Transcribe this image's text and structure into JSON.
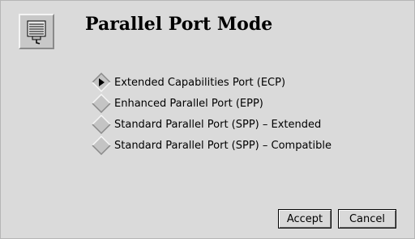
{
  "dialog": {
    "title": "Parallel Port Mode",
    "icon": "parallel-port-icon"
  },
  "options": [
    {
      "label": "Extended Capabilities Port (ECP)",
      "selected": true
    },
    {
      "label": "Enhanced Parallel Port (EPP)",
      "selected": false
    },
    {
      "label": "Standard Parallel Port (SPP) – Extended",
      "selected": false
    },
    {
      "label": "Standard Parallel Port (SPP) – Compatible",
      "selected": false
    }
  ],
  "buttons": {
    "accept": "Accept",
    "cancel": "Cancel"
  },
  "colors": {
    "background": "#dadada",
    "radio_face": "#c4c4c4"
  }
}
